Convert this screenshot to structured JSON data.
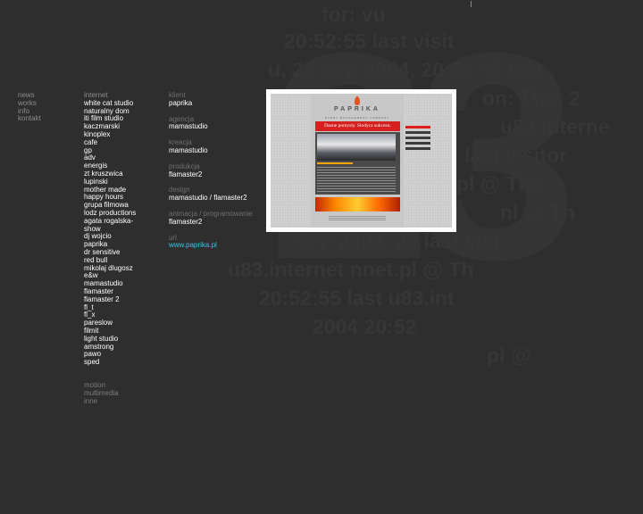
{
  "nav": [
    ".",
    "news",
    "works",
    "info",
    "kontakt",
    ".",
    ".",
    ".",
    ".",
    ".",
    ".",
    ".",
    ".",
    ".",
    ".",
    ".",
    "."
  ],
  "works": {
    "header": "internet",
    "items": [
      "white cat studio",
      "naturalny dom",
      "iti film studio",
      "kaczmarski",
      "kinoplex",
      "cafe",
      "gp",
      "adv",
      "energis",
      "zt kruszwica",
      "lupinski",
      "mother made",
      "happy hours",
      "grupa filmowa",
      "lodz productions",
      "agata rogalska-show",
      "dj wojcio",
      "paprika",
      "dr sensitive",
      "red bull",
      "mikolaj dlugosz",
      "e&w",
      "mamastudio",
      "flamaster",
      "flamaster 2",
      "fl_t",
      "fl_x",
      "pareslow",
      "filmit",
      "light studio",
      "amstrong",
      "pawo",
      "sped"
    ],
    "dot": ".",
    "other_categories": [
      "motion",
      "multimedia",
      "inne"
    ]
  },
  "details": {
    "klient_label": "klient",
    "klient": "paprika",
    "agencja_label": "agencja",
    "agencja": "mamastudio",
    "kreacja_label": "kreacja",
    "kreacja": "mamastudio",
    "produkcja_label": "produkcja",
    "produkcja": "flamaster2",
    "design_label": "design",
    "design": "mamastudio / flamaster2",
    "animacja_label": "animacja / programowanie",
    "animacja": "flamaster2",
    "url_label": "url",
    "url": "www.paprika.pl",
    "end_dot": "."
  },
  "preview": {
    "logo": "PAPRIKA",
    "subtitle": "EVENT MANAGEMENT COMPANY",
    "headline": "Dazne pomysly. Slodycz sukcesu."
  },
  "background": {
    "big_number": "23",
    "lines": [
      "for: vu",
      "20:52:55 last visit",
      "u, 23 Sep 2004, 20:52:55 last",
      "on: Thu, 2",
      "u83.interne",
      "last visitor",
      "net.pl @ Thu,",
      "nl @ Th",
      "Sep 2004, 20 last visi",
      "u83.internet nnet.pl @ Th",
      "20:52:55 last u83.int",
      "2004 20:52",
      "pl @"
    ]
  },
  "colors": {
    "background": "#2e2e2e",
    "link": "#ffffff",
    "label": "#6e6e6e",
    "url": "#33c6e5",
    "accent": "#d62020"
  }
}
